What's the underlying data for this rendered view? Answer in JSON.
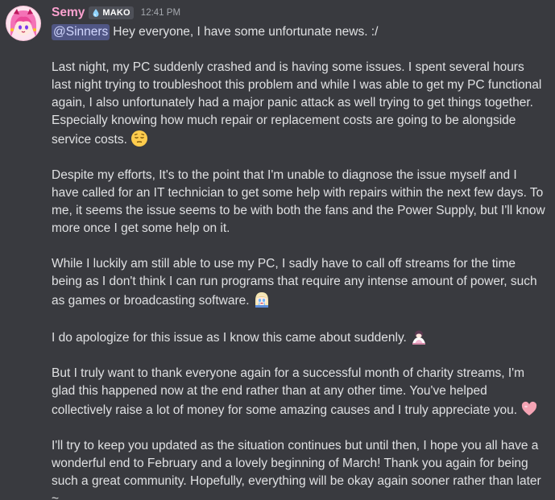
{
  "message": {
    "author": {
      "username": "Semy",
      "tag": "MAKO",
      "avatar": "anime-girl-avatar"
    },
    "timestamp": "12:41 PM",
    "mention": "@Sinners",
    "paragraphs": [
      {
        "text": "Hey everyone, I have some unfortunate news. :/",
        "emoji": null
      },
      {
        "text": "Last night, my PC suddenly crashed and is having some issues. I spent several hours last night trying to troubleshoot this problem and while I was able to get my PC functional again, I also unfortunately had a major panic attack as well trying to get things together. Especially knowing how much repair or replacement costs are going to be alongside service costs.",
        "emoji": "relieved-face-emoji"
      },
      {
        "text": "Despite my efforts, It's to the point that I'm unable to diagnose the issue myself and I have called for an IT technician to get some help with repairs within the next few days. To me, it seems the issue seems to be with both the fans and the Power Supply, but I'll know more once I get some help on it.",
        "emoji": null
      },
      {
        "text": "While I luckily am still able to use my PC, I sadly have to call off streams for the time being as I don't think I can run programs that require any intense amount of power, such as games or broadcasting software.",
        "emoji": "crying-anime-emoji"
      },
      {
        "text": "I do apologize for this issue as I know this came about suddenly.",
        "emoji": "bowing-anime-emoji"
      },
      {
        "text": "But I truly want to thank everyone again for a successful month of charity streams, I'm glad this happened now at the end rather than at any other time. You've helped collectively raise a lot of money for some amazing causes and I truly appreciate you.",
        "emoji": "heart-emoji"
      },
      {
        "text": "I'll try to keep you updated as the situation continues but until then, I hope you all have a wonderful end to February and a lovely beginning of March! Thank you again for being such a great community. Hopefully, everything will be okay again sooner rather than later ~",
        "emoji": null
      }
    ]
  },
  "colors": {
    "background": "#393a3f",
    "username": "#fba1cf",
    "mention_bg": "#505685",
    "mention_text": "#d3d8ff",
    "text": "#dfe0e2",
    "timestamp": "#a5a8ae"
  }
}
